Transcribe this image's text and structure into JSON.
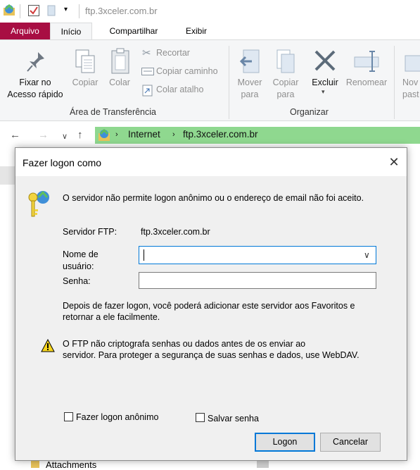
{
  "window": {
    "title": "ftp.3xceler.com.br"
  },
  "tabs": [
    "Arquivo",
    "Início",
    "Compartilhar",
    "Exibir"
  ],
  "ribbon": {
    "pin_label": [
      "Fixar no",
      "Acesso rápido"
    ],
    "copy_label": "Copiar",
    "paste_label": "Colar",
    "cut_label": "Recortar",
    "copy_path_label": "Copiar caminho",
    "paste_shortcut_label": "Colar atalho",
    "clipboard_group": "Área de Transferência",
    "move_label": [
      "Mover",
      "para"
    ],
    "copyto_label": [
      "Copiar",
      "para"
    ],
    "delete_label": "Excluir",
    "rename_label": "Renomear",
    "new_label": [
      "Nov",
      "past"
    ],
    "organize_group": "Organizar"
  },
  "address": {
    "root": "Internet",
    "site": "ftp.3xceler.com.br"
  },
  "dialog": {
    "title": "Fazer logon como",
    "message": "O servidor não permite logon anônimo ou o endereço de email não foi aceito.",
    "server_label": "Servidor FTP:",
    "server_value": "ftp.3xceler.com.br",
    "user_label": [
      "Nome de",
      "usuário:"
    ],
    "user_value": "",
    "password_label": "Senha:",
    "info": [
      "Depois de fazer logon, você poderá adicionar este servidor aos Favoritos e",
      "retornar a ele facilmente."
    ],
    "warning": [
      "O FTP não criptografa senhas ou dados antes de os enviar ao",
      "servidor. Para proteger a segurança de suas senhas e dados, use WebDAV."
    ],
    "anon_label": "Fazer logon anônimo",
    "save_label": "Salvar senha",
    "logon_button": "Logon",
    "cancel_button": "Cancelar"
  },
  "filelist": {
    "partial_item": "Attachments"
  },
  "colors": {
    "file_tab": "#a80e43",
    "address_bg": "#8fd88f",
    "ribbon_bg": "#f5f6f7",
    "dialog_bg": "#f0f0f0",
    "focus_border": "#0078d7"
  }
}
